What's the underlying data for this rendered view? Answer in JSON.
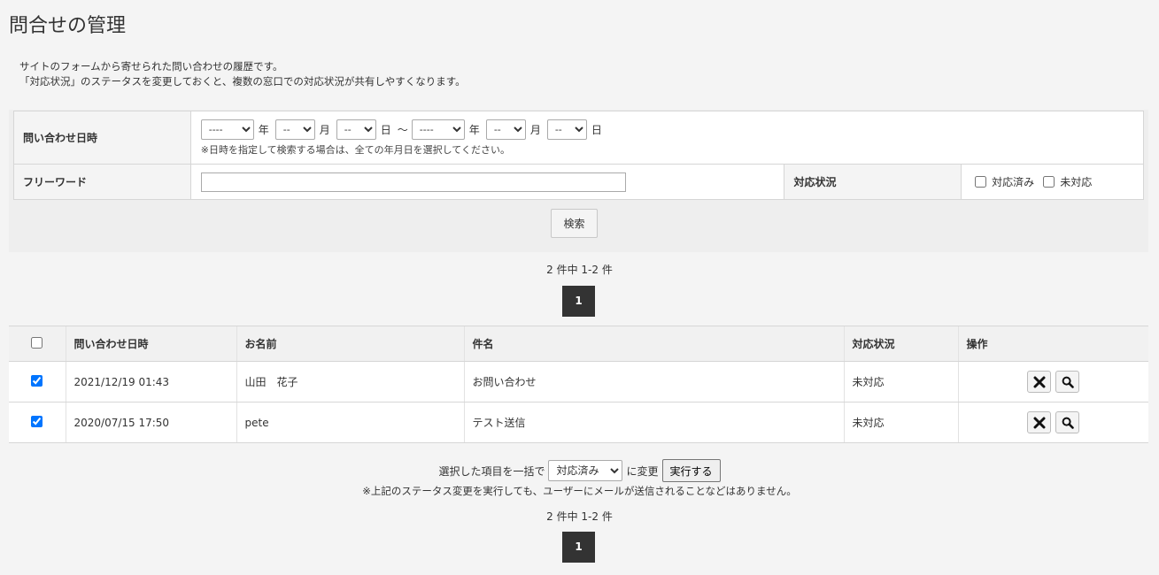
{
  "page": {
    "title": "問合せの管理",
    "description": [
      "サイトのフォームから寄せられた問い合わせの履歴です。",
      "「対応状況」のステータスを変更しておくと、複数の窓口での対応状況が共有しやすくなります。"
    ]
  },
  "search": {
    "date_label": "問い合わせ日時",
    "year_placeholder": "----",
    "md_placeholder": "--",
    "year_unit": "年",
    "month_unit": "月",
    "day_unit": "日",
    "range_sep": "～",
    "date_note": "※日時を指定して検索する場合は、全ての年月日を選択してください。",
    "freeword_label": "フリーワード",
    "freeword_value": "",
    "status_label": "対応状況",
    "status_done": "対応済み",
    "status_todo": "未対応",
    "search_button": "検索"
  },
  "pagination": {
    "count_text": "2 件中 1-2 件",
    "current_page": "1"
  },
  "table": {
    "headers": [
      "問い合わせ日時",
      "お名前",
      "件名",
      "対応状況",
      "操作"
    ],
    "rows": [
      {
        "checked": true,
        "datetime": "2021/12/19 01:43",
        "name": "山田　花子",
        "subject": "お問い合わせ",
        "status": "未対応"
      },
      {
        "checked": true,
        "datetime": "2020/07/15 17:50",
        "name": "pete",
        "subject": "テスト送信",
        "status": "未対応"
      }
    ]
  },
  "bulk": {
    "prefix": "選択した項目を一括で",
    "selected_option": "対応済み",
    "suffix": "に変更",
    "execute_button": "実行する",
    "note": "※上記のステータス変更を実行しても、ユーザーにメールが送信されることなどはありません。"
  },
  "icons": {
    "delete": "close-icon",
    "view": "search-icon"
  }
}
